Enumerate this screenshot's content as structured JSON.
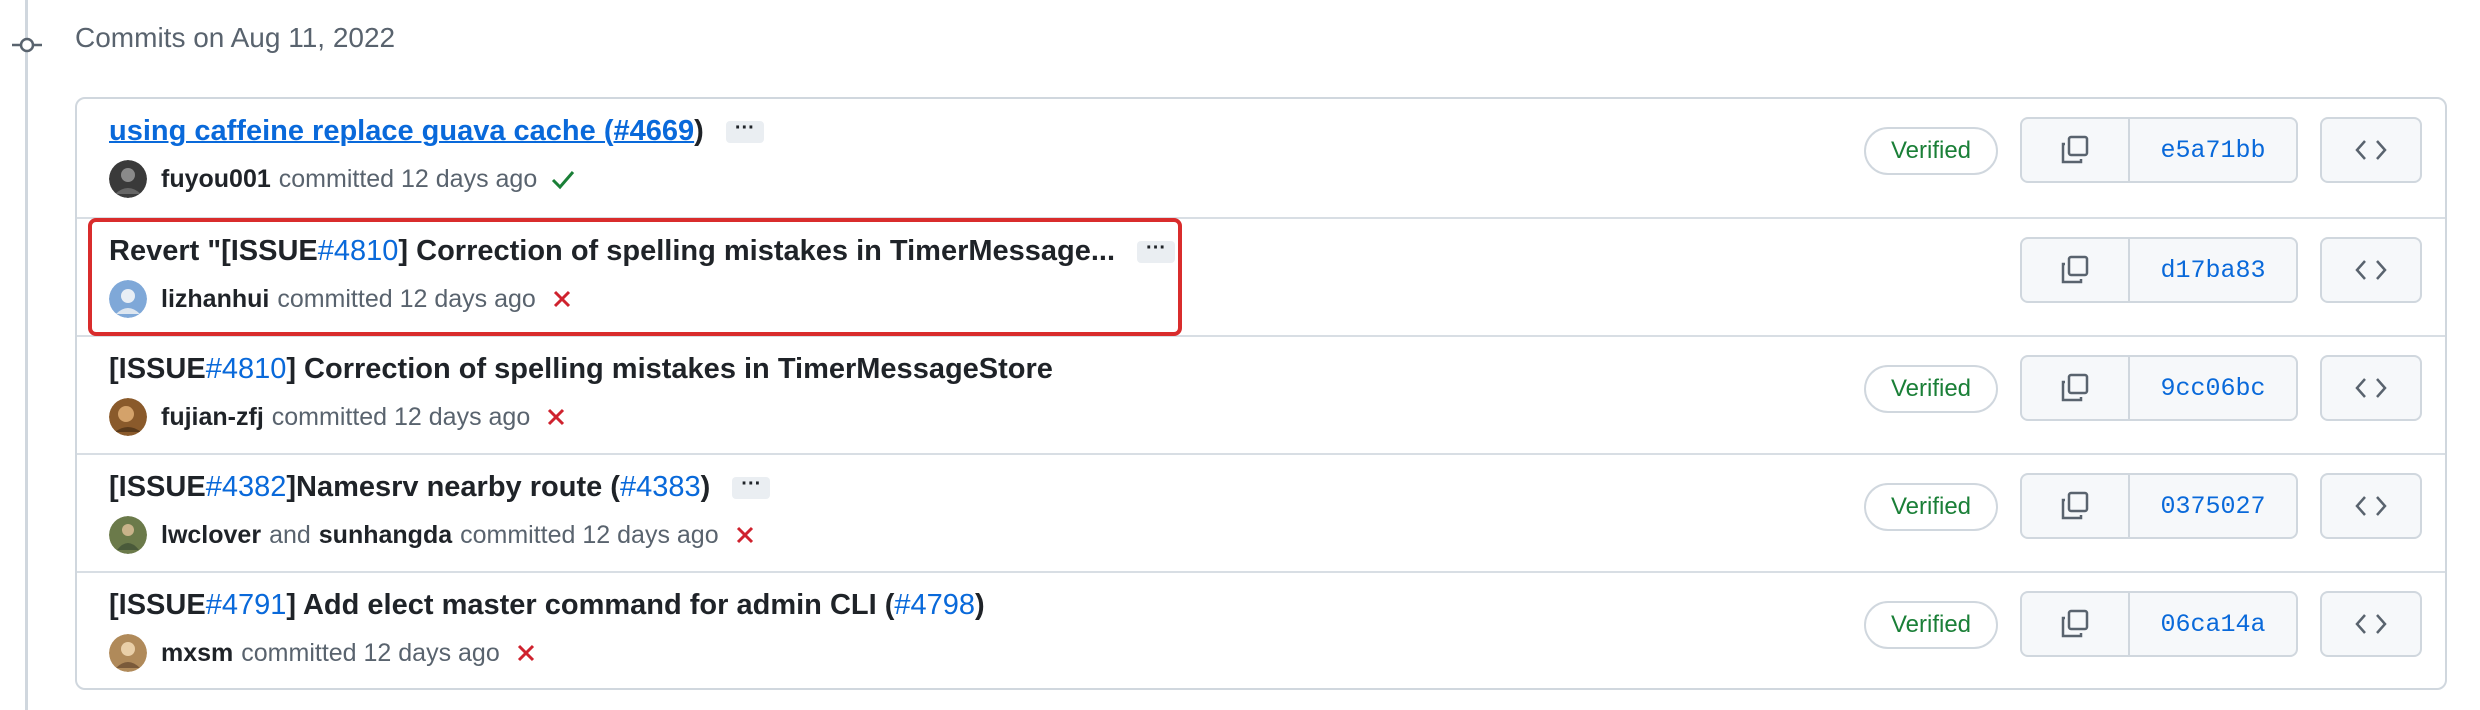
{
  "group": {
    "heading": "Commits on Aug 11, 2022"
  },
  "commits": [
    {
      "title_parts": [
        "using caffeine replace guava cache (",
        "#4669",
        ")"
      ],
      "author": "fuyou001",
      "action": "committed 12 days ago",
      "status": "success",
      "verified": "Verified",
      "sha": "e5a71bb",
      "has_ellipsis": true,
      "ellipsis": "···"
    },
    {
      "title_parts": [
        "Revert \"[ISSUE ",
        "#4810",
        "] Correction of spelling mistakes in TimerMessage..."
      ],
      "author": "lizhanhui",
      "action": "committed 12 days ago",
      "status": "failure",
      "verified": "",
      "sha": "d17ba83",
      "has_ellipsis": true,
      "ellipsis": "···"
    },
    {
      "title_parts": [
        "[ISSUE ",
        "#4810",
        "] Correction of spelling mistakes in TimerMessageStore"
      ],
      "author": "fujian-zfj",
      "action": "committed 12 days ago",
      "status": "failure",
      "verified": "Verified",
      "sha": "9cc06bc",
      "has_ellipsis": false
    },
    {
      "title_parts": [
        "[ISSUE ",
        "#4382",
        "]Namesrv nearby route (",
        "#4383",
        ")"
      ],
      "author": "lwclover",
      "conjunction": "and",
      "coauthor": "sunhangda",
      "action": "committed 12 days ago",
      "status": "failure",
      "verified": "Verified",
      "sha": "0375027",
      "has_ellipsis": true,
      "ellipsis": "···"
    },
    {
      "title_parts": [
        "[ISSUE ",
        "#4791",
        "] Add elect master command for admin CLI (",
        "#4798",
        ")"
      ],
      "author": "mxsm",
      "action": "committed 12 days ago",
      "status": "failure",
      "verified": "Verified",
      "sha": "06ca14a",
      "has_ellipsis": false
    }
  ],
  "colors": {
    "link": "#0969da",
    "verified": "#1a7f37",
    "failure": "#cf222e",
    "highlight": "#d92c2c"
  },
  "icons": {
    "timeline": "git-commit-icon",
    "copy": "copy-icon",
    "browse": "code-icon",
    "success": "check-icon",
    "failure": "x-icon"
  }
}
